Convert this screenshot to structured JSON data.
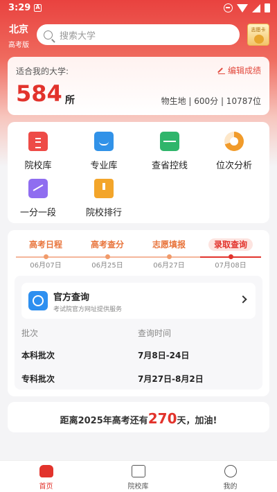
{
  "status_bar": {
    "time": "3:29",
    "badge": "A"
  },
  "header": {
    "city": "北京",
    "exam_version": "高考版",
    "search_placeholder": "搜索大学",
    "volunteer_card_label": "志愿卡"
  },
  "uni_card": {
    "label": "适合我的大学:",
    "edit_label": "编辑成绩",
    "count": "584",
    "unit": "所",
    "info": "物生地 | 600分 | 10787位"
  },
  "tools": [
    {
      "label": "院校库",
      "icon": "school-library-icon"
    },
    {
      "label": "专业库",
      "icon": "major-library-icon"
    },
    {
      "label": "查省控线",
      "icon": "score-line-icon"
    },
    {
      "label": "位次分析",
      "icon": "rank-analysis-icon"
    },
    {
      "label": "一分一段",
      "icon": "score-segment-icon"
    },
    {
      "label": "院校排行",
      "icon": "school-ranking-icon"
    }
  ],
  "timeline": {
    "steps": [
      {
        "label": "高考日程",
        "date": "06月07日"
      },
      {
        "label": "高考查分",
        "date": "06月25日"
      },
      {
        "label": "志愿填报",
        "date": "06月27日"
      },
      {
        "label": "录取查询",
        "date": "07月08日"
      }
    ],
    "active_index": 3
  },
  "official": {
    "title": "官方查询",
    "subtitle": "考试院官方网址提供服务"
  },
  "table": {
    "headers": [
      "批次",
      "查询时间"
    ],
    "rows": [
      [
        "本科批次",
        "7月8日-24日"
      ],
      [
        "专科批次",
        "7月27日-8月2日"
      ]
    ]
  },
  "countdown": {
    "prefix": "距离2025年高考还有",
    "days": "270",
    "suffix": "天，加油!"
  },
  "tabbar": {
    "items": [
      {
        "label": "首页",
        "icon": "home-icon"
      },
      {
        "label": "院校库",
        "icon": "graduation-cap-icon"
      },
      {
        "label": "我的",
        "icon": "profile-face-icon"
      }
    ],
    "active_index": 0
  },
  "colors": {
    "accent": "#e2332c",
    "timeline": "#e8743b"
  }
}
